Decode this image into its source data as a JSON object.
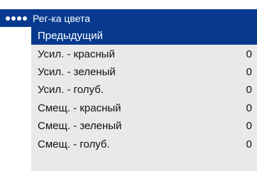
{
  "header": {
    "icon": "four-dots-icon",
    "title": "Рег-ка цвета"
  },
  "menu": {
    "items": [
      {
        "label": "Предыдущий",
        "value": "",
        "selected": true
      },
      {
        "label": "Усил. - красный",
        "value": "0",
        "selected": false
      },
      {
        "label": "Усил. - зеленый",
        "value": "0",
        "selected": false
      },
      {
        "label": "Усил. - голуб.",
        "value": "0",
        "selected": false
      },
      {
        "label": "Смещ. - красный",
        "value": "0",
        "selected": false
      },
      {
        "label": "Смещ. - зеленый",
        "value": "0",
        "selected": false
      },
      {
        "label": "Смещ. - голуб.",
        "value": "0",
        "selected": false
      }
    ]
  },
  "colors": {
    "highlight": "#073a8e",
    "panel": "#e9e9e9",
    "text": "#111111"
  }
}
